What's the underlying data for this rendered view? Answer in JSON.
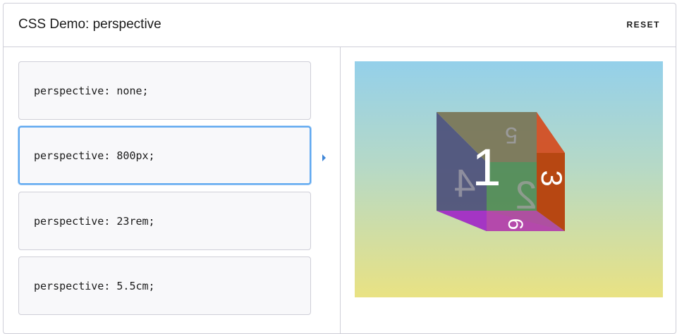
{
  "header": {
    "title": "CSS Demo: perspective",
    "reset_label": "RESET"
  },
  "options": [
    {
      "code": "perspective: none;",
      "selected": false
    },
    {
      "code": "perspective: 800px;",
      "selected": true
    },
    {
      "code": "perspective: 23rem;",
      "selected": false
    },
    {
      "code": "perspective: 5.5cm;",
      "selected": false
    }
  ],
  "cube": {
    "faces": [
      "1",
      "2",
      "3",
      "4",
      "5",
      "6"
    ],
    "colors": {
      "front": "#4f8a55",
      "top": "#7a7455",
      "left": "#4c4f7a",
      "right": "#d5481b",
      "bottom": "#b22fd0"
    }
  },
  "colors": {
    "accent": "#5fa8f0",
    "gradient_top": "#94d0ea",
    "gradient_bottom": "#e9e283"
  }
}
